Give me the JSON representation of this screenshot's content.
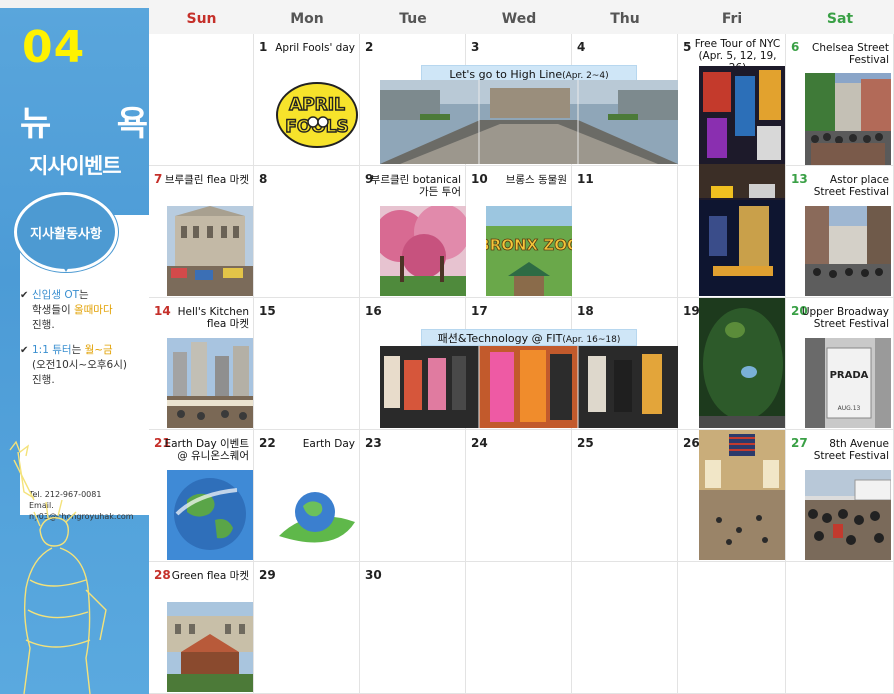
{
  "sidebar": {
    "month": "04",
    "title_word1": "뉴",
    "title_word2": "욕",
    "subtitle": "지사이벤트",
    "bubble": "지사활동사항",
    "notes": [
      {
        "p1": "신입생 OT",
        "p2": "는",
        "p3": "학생들이 ",
        "p4": "올때마다",
        "p5": "진행."
      },
      {
        "p1": "1:1 튜터",
        "p2": "는 ",
        "p3": "월~금",
        "p4": "(오전10시~오후6시)",
        "p5": "진행."
      }
    ],
    "tel": "Tel.  212-967-0081",
    "email": "Email.  ny03@chongroyuhak.com"
  },
  "days": [
    "Sun",
    "Mon",
    "Tue",
    "Wed",
    "Thu",
    "Fri",
    "Sat"
  ],
  "colors": {
    "sun": "#c5302a",
    "sat": "#3aa046",
    "accent": "#4d9ad2",
    "month": "#fff200"
  },
  "cells": {
    "d1": {
      "num": "1",
      "event": "April Fools' day"
    },
    "d2": {
      "num": "2"
    },
    "d3": {
      "num": "3"
    },
    "d4": {
      "num": "4"
    },
    "d5": {
      "num": "5",
      "event": "Free Tour of NYC\n(Apr. 5, 12, 19, 26)"
    },
    "d6": {
      "num": "6",
      "event": "Chelsea Street\nFestival"
    },
    "d7": {
      "num": "7",
      "event": "브루클린 flea 마켓"
    },
    "d8": {
      "num": "8"
    },
    "d9": {
      "num": "9",
      "event": "부르클린 botanical\n가든 투어"
    },
    "d10": {
      "num": "10",
      "event": "브롱스 동물원"
    },
    "d11": {
      "num": "11"
    },
    "d12": {
      "num": "12"
    },
    "d13": {
      "num": "13",
      "event": "Astor place\nStreet Festival"
    },
    "d14": {
      "num": "14",
      "event": "Hell's Kitchen\nflea 마켓"
    },
    "d15": {
      "num": "15"
    },
    "d16": {
      "num": "16"
    },
    "d17": {
      "num": "17"
    },
    "d18": {
      "num": "18"
    },
    "d19": {
      "num": "19"
    },
    "d20": {
      "num": "20",
      "event": "Upper Broadway\nStreet Festival"
    },
    "d21": {
      "num": "21",
      "event": "Earth Day 이벤트\n@ 유니온스퀘어"
    },
    "d22": {
      "num": "22",
      "event": "Earth Day"
    },
    "d23": {
      "num": "23"
    },
    "d24": {
      "num": "24"
    },
    "d25": {
      "num": "25"
    },
    "d26": {
      "num": "26"
    },
    "d27": {
      "num": "27",
      "event": "8th Avenue\nStreet Festival"
    },
    "d28": {
      "num": "28",
      "event": "Green flea 마켓"
    },
    "d29": {
      "num": "29"
    },
    "d30": {
      "num": "30"
    }
  },
  "multi_events": {
    "highline": {
      "label": "Let's go to High Line",
      "dates": "(Apr. 2~4)"
    },
    "fit": {
      "label": "패션&Technology @ FIT",
      "dates": "(Apr. 16~18)"
    }
  },
  "images": {
    "april_fools": {
      "line1": "APRIL",
      "line2": "FOOLS"
    },
    "bronx_zoo": "BRONX ZOO",
    "prada": "PRADA",
    "prada_sub": "AUG.13"
  }
}
